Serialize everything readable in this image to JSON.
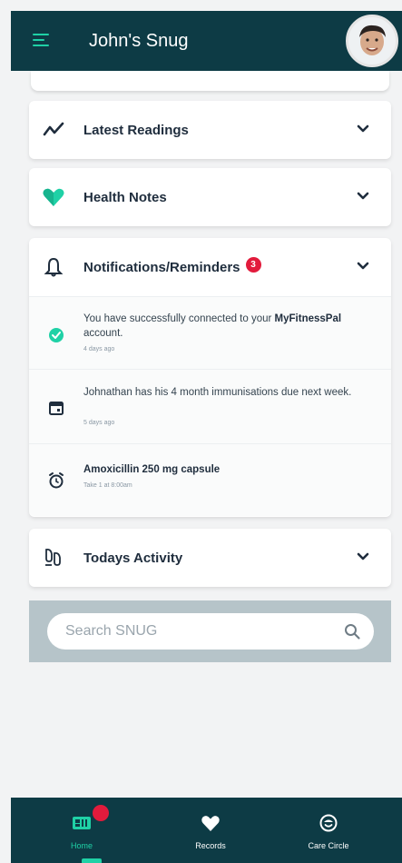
{
  "header": {
    "title": "John's Snug"
  },
  "cards": {
    "latest_readings": {
      "title": "Latest Readings"
    },
    "health_notes": {
      "title": "Health Notes"
    },
    "notifications": {
      "title": "Notifications/Reminders",
      "badge": "3",
      "items": [
        {
          "text_pre": "You have successfully connected to your ",
          "text_bold": "MyFitnessPal",
          "text_post": " account.",
          "time": "4 days ago",
          "icon": "check-circle-icon"
        },
        {
          "text_pre": "Johnathan has his 4 month immunisations due next week.",
          "text_bold": "",
          "text_post": "",
          "time": "5 days ago",
          "icon": "calendar-icon"
        },
        {
          "text_pre": "",
          "text_bold": "Amoxicillin 250 mg capsule",
          "text_post": "",
          "time": "Take 1 at 8:00am",
          "icon": "alarm-clock-icon"
        }
      ]
    },
    "todays_activity": {
      "title": "Todays Activity"
    }
  },
  "search": {
    "placeholder": "Search SNUG"
  },
  "nav": {
    "home": "Home",
    "records": "Records",
    "care_circle": "Care Circle"
  },
  "colors": {
    "primary": "#0d3b45",
    "accent": "#1fd1a6",
    "badge": "#e21b3c"
  }
}
